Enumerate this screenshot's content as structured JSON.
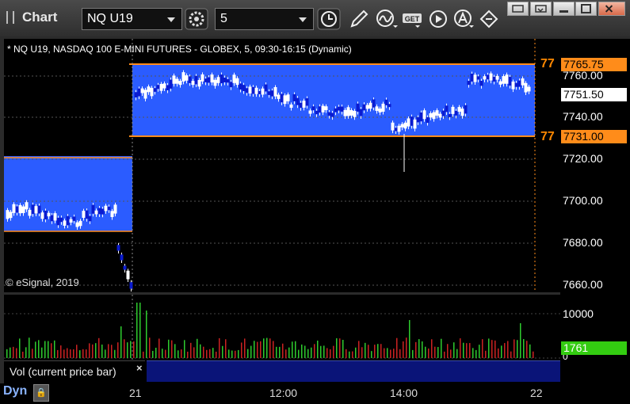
{
  "window": {
    "title": "Chart"
  },
  "toolbar": {
    "symbol": "NQ U19",
    "interval": "5"
  },
  "chart": {
    "label": "* NQ U19, NASDAQ 100 E-MINI FUTURES - GLOBEX, 5, 09:30-16:15 (Dynamic)",
    "copyright": "© eSignal, 2019",
    "price_ticks": [
      "7760.00",
      "7740.00",
      "7720.00",
      "7700.00",
      "7680.00",
      "7660.00"
    ],
    "price_tags": {
      "upper": "7765.75",
      "last": "7751.50",
      "lower": "7731.00"
    },
    "line_tag_text": "77",
    "time_ticks": [
      "21",
      "12:00",
      "14:00",
      "22"
    ]
  },
  "volume": {
    "label": "Vol (current price bar)",
    "close_glyph": "×",
    "ticks": [
      "10000",
      "0"
    ],
    "last_value": "1761"
  },
  "status": {
    "mode": "Dyn"
  },
  "colors": {
    "band": "#2b5cff",
    "line": "#ff8c1a",
    "up_vol": "#2ecc2e",
    "down_vol": "#cc2222",
    "last_tag": "#ffffff",
    "orange_tag": "#ff8c1a",
    "vol_tag": "#33cc11"
  }
}
